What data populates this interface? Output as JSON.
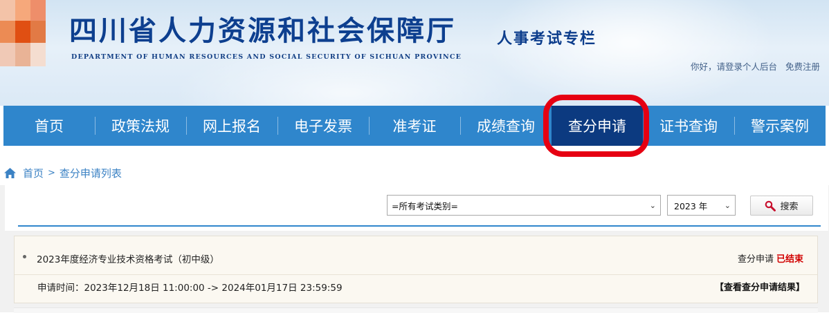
{
  "header": {
    "site_title": "四川省人力资源和社会保障厅",
    "site_subtitle": "DEPARTMENT OF HUMAN RESOURCES AND SOCIAL SECURITY OF SICHUAN PROVINCE",
    "column_title": "人事考试专栏",
    "login_text": "你好，请登录个人后台",
    "register_text": "免费注册"
  },
  "nav": {
    "items": [
      {
        "label": "首页"
      },
      {
        "label": "政策法规"
      },
      {
        "label": "网上报名"
      },
      {
        "label": "电子发票"
      },
      {
        "label": "准考证"
      },
      {
        "label": "成绩查询"
      },
      {
        "label": "查分申请",
        "active": true
      },
      {
        "label": "证书查询"
      },
      {
        "label": "警示案例"
      }
    ]
  },
  "breadcrumb": {
    "home": "首页",
    "separator": ">",
    "current": "查分申请列表"
  },
  "filters": {
    "exam_type_selected": "=所有考试类别=",
    "year_selected": "2023 年",
    "search_label": "搜索"
  },
  "list": [
    {
      "title": "2023年度经济专业技术资格考试（初中级）",
      "status_label": "查分申请",
      "status_value": "已结束",
      "time_label": "申请时间：",
      "time_range": "2023年12月18日 11:00:00 -> 2024年01月17日 23:59:59",
      "result_link": "【查看查分申请结果】"
    }
  ],
  "colors": {
    "nav_bg": "#2f86cc",
    "nav_active": "#0c3a80",
    "highlight": "#e60012",
    "status_ended": "#d10000"
  }
}
